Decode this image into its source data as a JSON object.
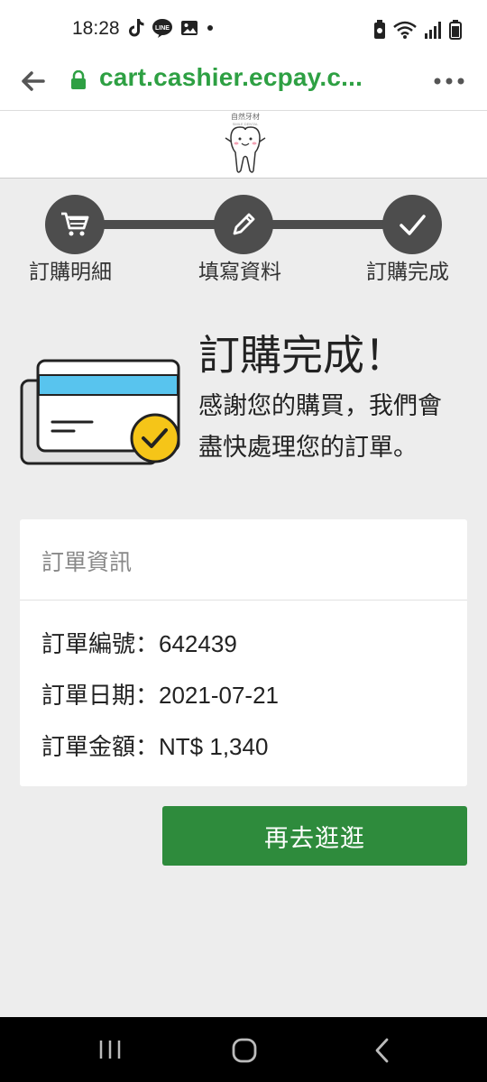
{
  "status_bar": {
    "time": "18:28",
    "left_icons": [
      "tiktok-icon",
      "line-icon",
      "gallery-icon",
      "dot-icon"
    ],
    "right_icons": [
      "battery-saver-icon",
      "wifi-icon",
      "signal-icon",
      "battery-icon"
    ]
  },
  "browser": {
    "url": "cart.cashier.ecpay.c...",
    "secure": true,
    "url_color": "#2ea043"
  },
  "header": {
    "logo_text": "自然牙材",
    "logo_subtext": "SMILE DENTAL"
  },
  "steps": [
    {
      "label": "訂購明細",
      "icon": "cart-icon"
    },
    {
      "label": "填寫資料",
      "icon": "pencil-icon"
    },
    {
      "label": "訂購完成",
      "icon": "check-icon"
    }
  ],
  "done": {
    "title": "訂購完成！",
    "message": "感謝您的購買，我們會盡快處理您的訂單。"
  },
  "order_info": {
    "heading": "訂單資訊",
    "rows": [
      {
        "label": "訂單編號：",
        "value": "642439"
      },
      {
        "label": "訂單日期：",
        "value": "2021-07-21"
      },
      {
        "label": "訂單金額：",
        "value": "NT$ 1,340"
      }
    ]
  },
  "continue_button": {
    "label": "再去逛逛",
    "color": "#2e8b3c"
  },
  "colors": {
    "step_active": "#4d4d4d",
    "card_blue": "#58c4ee",
    "badge_yellow": "#f5c518"
  }
}
